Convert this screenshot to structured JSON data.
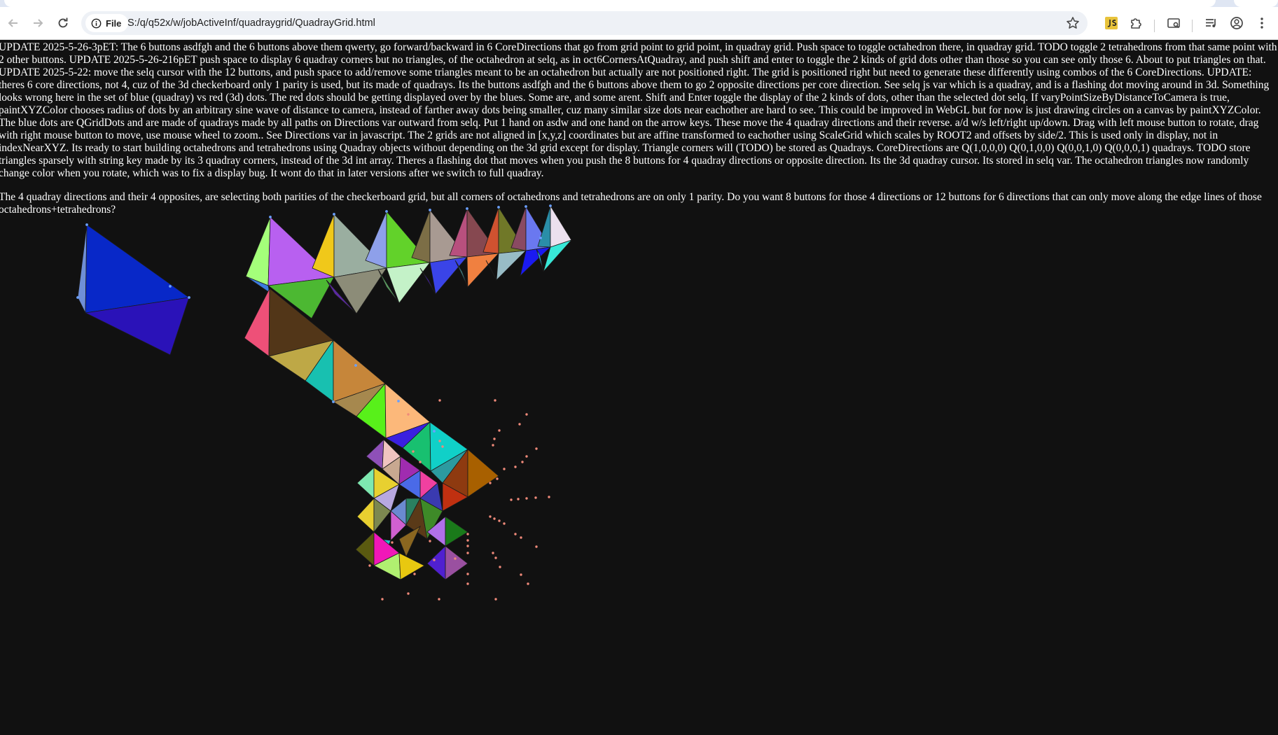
{
  "browser": {
    "site_chip": "File",
    "url": "S:/q/q52x/w/jobActiveInf/quadraygrid/QuadrayGrid.html",
    "icons": {
      "back": "arrow-left-icon",
      "forward": "arrow-right-icon",
      "reload": "reload-icon",
      "info": "info-icon",
      "bookmark": "star-icon",
      "extension_js": "js-extension-icon",
      "extensions": "puzzle-icon",
      "cast": "cast-icon",
      "media": "media-control-icon",
      "profile": "profile-icon",
      "menu": "kebab-menu-icon"
    }
  },
  "page": {
    "paragraph1": "UPDATE 2025-5-26-3pET: The 6 buttons asdfgh and the 6 buttons above them qwerty, go forward/backward in 6 CoreDirections that go from grid point to grid point, in quadray grid. Push space to toggle octahedron there, in quadray grid. TODO toggle 2 tetrahedrons from that same point with 2 other buttons. UPDATE 2025-5-26-216pET push space to display 6 quadray corners but no triangles, of the octahedron at selq, as in oct6CornersAtQuadray, and push shift and enter to toggle the 2 kinds of grid dots other than those so you can see only those 6. About to put triangles on that. UPDATE 2025-5-22: move the selq cursor with the 12 buttons, and push space to add/remove some triangles meant to be an octahedron but actually are not positioned right. The grid is positioned right but need to generate these differently using combos of the 6 CoreDirections. UPDATE: theres 6 core directions, not 4, cuz of the 3d checkerboard only 1 parity is used, but its made of quadrays. Its the buttons asdfgh and the 6 buttons above them to go 2 opposite directions per core direction. See selq js var which is a quadray, and is a flashing dot moving around in 3d. Something looks wrong here in the set of blue (quadray) vs red (3d) dots. The red dots should be getting displayed over by the blues. Some are, and some arent. Shift and Enter toggle the display of the 2 kinds of dots, other than the selected dot selq. If varyPointSizeByDistanceToCamera is true, paintXYZColor chooses radius of dots by an arbitrary sine wave of distance to camera, instead of farther away dots being smaller, cuz many similar size dots near eachother are hard to see. This could be improved in WebGL but for now is just drawing circles on a canvas by paintXYZColor. The blue dots are QGridDots and are made of quadrays made by all paths on Directions var outward from selq. Put 1 hand on asdw and one hand on the arrow keys. These move the 4 quadray directions and their reverse. a/d w/s left/right up/down. Drag with left mouse button to rotate, drag with right mouse button to move, use mouse wheel to zoom.. See Directions var in javascript. The 2 grids are not aligned in [x,y,z] coordinates but are affine transformed to eachother using ScaleGrid which scales by ROOT2 and offsets by side/2. This is used only in display, not in indexNearXYZ. Its ready to start building octahedrons and tetrahedrons using Quadray objects without depending on the 3d grid except for display. Triangle corners will (TODO) be stored as Quadrays. CoreDirections are Q(1,0,0,0) Q(0,1,0,0) Q(0,0,1,0) Q(0,0,0,1) quadrays. TODO store triangles sparsely with string key made by its 3 quadray corners, instead of the 3d int array. Theres a flashing dot that moves when you push the 8 buttons for 4 quadray directions or opposite direction. Its the 3d quadray cursor. Its stored in selq var. The octahedron triangles now randomly change color when you rotate, which was to fix a display bug. It wont do that in later versions after we switch to full quadray.",
    "paragraph2": "The 4 quadray directions and their 4 opposites, are selecting both parities of the checkerboard grid, but all corners of octahedrons and tetrahedrons are on only 1 parity. Do you want 8 buttons for those 4 directions or 12 buttons for 6 directions that can only move along the edge lines of those octahedrons+tetrahedrons?"
  },
  "colors": {
    "page_background": "#111111",
    "page_text": "#ffffff",
    "toolbar_background": "#ffffff",
    "omnibox_background": "#eef1f6",
    "grid_dot_red": "#f08a7a",
    "grid_dot_blue": "#6aa0ff"
  }
}
